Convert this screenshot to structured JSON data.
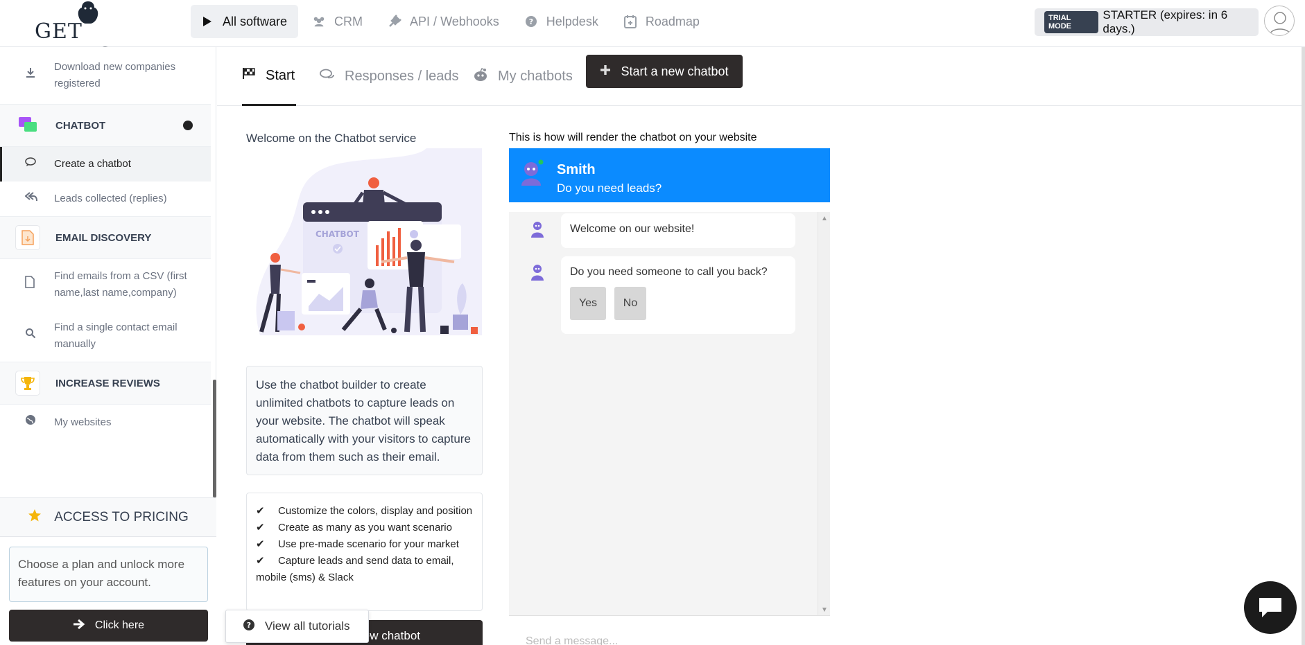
{
  "brand": {
    "logo_text": "GET LEADS"
  },
  "nav": [
    {
      "label": "All software",
      "icon": "play-icon"
    },
    {
      "label": "CRM",
      "icon": "users-icon"
    },
    {
      "label": "API / Webhooks",
      "icon": "plug-icon"
    },
    {
      "label": "Helpdesk",
      "icon": "question-icon"
    },
    {
      "label": "Roadmap",
      "icon": "calendar-icon"
    }
  ],
  "trial": {
    "badge": "TRIAL MODE",
    "text": "STARTER (expires: in 6 days.)"
  },
  "sidebar": {
    "download_item": "Download new companies registered",
    "chatbot_section": "CHATBOT",
    "create_chatbot": "Create a chatbot",
    "leads_collected": "Leads collected (replies)",
    "email_section": "EMAIL DISCOVERY",
    "find_csv": "Find emails from a CSV (first name,last name,company)",
    "find_single": "Find a single contact email manually",
    "reviews_section": "INCREASE REVIEWS",
    "my_websites": "My websites"
  },
  "pricing": {
    "title": "ACCESS TO PRICING",
    "text": "Choose a plan and unlock more features on your account.",
    "button": "Click here"
  },
  "tabs": [
    {
      "label": "Start",
      "icon": "flag-icon"
    },
    {
      "label": "Responses / leads",
      "icon": "comments-icon"
    },
    {
      "label": "My chatbots",
      "icon": "reddit-icon"
    }
  ],
  "new_chatbot_button": "Start a new chatbot",
  "content": {
    "welcome": "Welcome on the Chatbot service",
    "illustration_label": "CHATBOT",
    "description": "Use the chatbot builder to create unlimited chatbots to capture leads on your website. The chatbot will speak automatically with your visitors to capture data from them such as their email.",
    "features": [
      "Customize the colors, display and position",
      "Create as many as you want scenario",
      "Use pre-made scenario for your market",
      "Capture leads and send data to email, mobile (sms) & Slack"
    ],
    "bottom_button": "Start a new chatbot",
    "tutorials": "View all tutorials"
  },
  "chat_preview": {
    "title": "This is how will render the chatbot on your website",
    "bot_name": "Smith",
    "bot_subtitle": "Do you need leads?",
    "messages": [
      "Welcome on our website!",
      "Do you need someone to call you back?"
    ],
    "choices": [
      "Yes",
      "No"
    ],
    "input_placeholder": "Send a message..."
  },
  "colors": {
    "chat_header": "#0b8bff",
    "dark_button": "#2f2b2b",
    "status_online": "#22c55e"
  }
}
